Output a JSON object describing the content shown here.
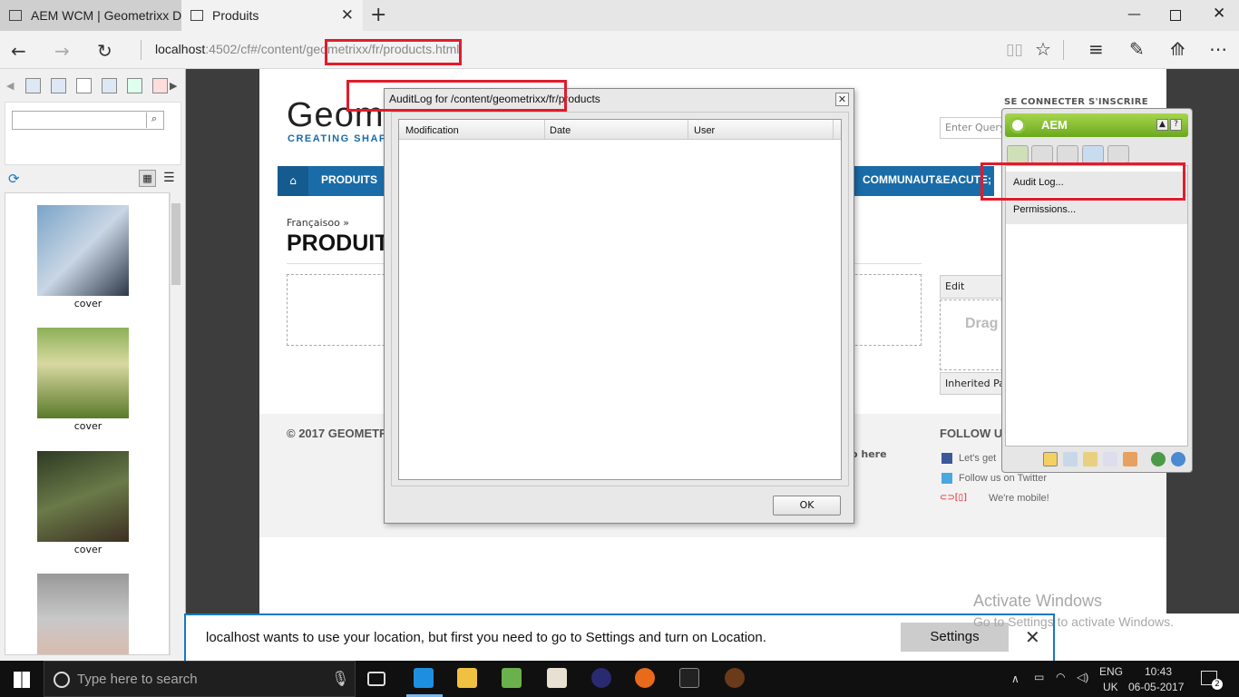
{
  "browser": {
    "tabs": [
      {
        "label": "AEM WCM | Geometrixx De",
        "active": false
      },
      {
        "label": "Produits",
        "active": true
      }
    ],
    "url_host": "localhost",
    "url_path": ":4502/cf#/content/geometrixx/fr/products.html"
  },
  "left_panel": {
    "items": [
      {
        "caption": "cover"
      },
      {
        "caption": "cover"
      },
      {
        "caption": "cover"
      }
    ]
  },
  "page": {
    "logo": "Geom",
    "logo_sub": "CREATING SHAP",
    "top_links": "SE CONNECTER   S'INSCRIRE",
    "query_placeholder": "Enter Query",
    "nav": {
      "home_icon": "home-icon",
      "produits": "PRODUITS",
      "communaute": "COMMUNAUT&EACUTE;"
    },
    "breadcrumb": "Françaisoo »",
    "title": "PRODUIT",
    "edit_label": "Edit",
    "drag_label": "Drag",
    "inherited_label": "Inherited Par",
    "copyright": "© 2017 GEOMETR",
    "follow": "FOLLOW U",
    "social": [
      "Let's get",
      "Follow us on Twitter",
      "We're mobile!"
    ],
    "here_link": "o here"
  },
  "audit_dialog": {
    "title": "AuditLog for /content/geometrixx/fr/products",
    "columns": [
      "Modification",
      "Date",
      "User"
    ],
    "rows": [],
    "ok_label": "OK"
  },
  "sidekick": {
    "title": "AEM",
    "menu": [
      "Audit Log...",
      "Permissions..."
    ]
  },
  "notification": {
    "text": "localhost wants to use your location, but first you need to go to Settings and turn on Location.",
    "settings_label": "Settings"
  },
  "watermark": {
    "line1": "Activate Windows",
    "line2": "Go to Settings to activate Windows."
  },
  "taskbar": {
    "search_placeholder": "Type here to search",
    "lang1": "ENG",
    "lang2": "UK",
    "time": "10:43",
    "date": "06-05-2017",
    "notif_count": "2"
  },
  "colors": {
    "nav_blue": "#1a6ca8",
    "aem_green": "#8cc63f",
    "highlight_red": "#e21b2b"
  }
}
